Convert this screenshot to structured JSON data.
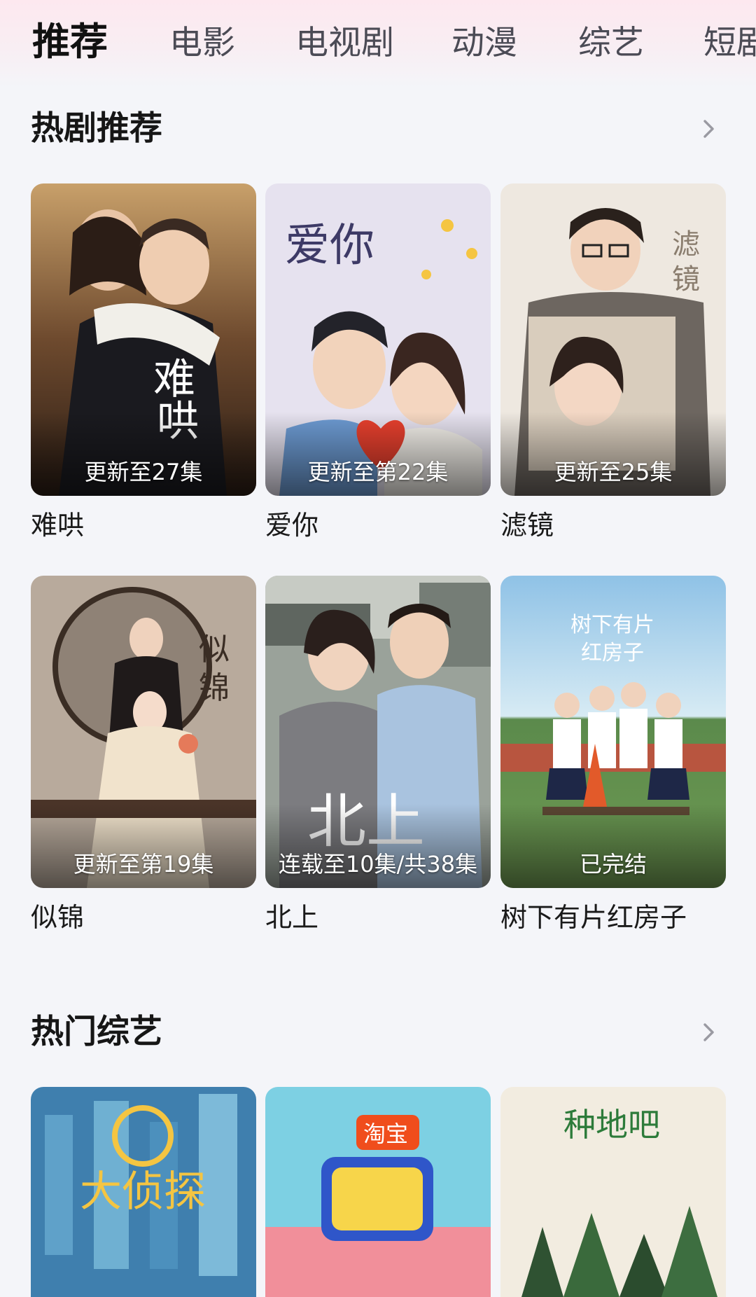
{
  "nav": {
    "tabs": [
      {
        "label": "推荐",
        "active": true
      },
      {
        "label": "电影",
        "active": false
      },
      {
        "label": "电视剧",
        "active": false
      },
      {
        "label": "动漫",
        "active": false
      },
      {
        "label": "综艺",
        "active": false
      },
      {
        "label": "短剧",
        "active": false
      }
    ]
  },
  "hot_dramas": {
    "title": "热剧推荐",
    "more_icon": "chevron-right-icon",
    "items": [
      {
        "title": "难哄",
        "badge": "更新至27集"
      },
      {
        "title": "爱你",
        "badge": "更新至第22集"
      },
      {
        "title": "滤镜",
        "badge": "更新至25集"
      },
      {
        "title": "似锦",
        "badge": "更新至第19集"
      },
      {
        "title": "北上",
        "badge": "连载至10集/共38集"
      },
      {
        "title": "树下有片红房子",
        "badge": "已完结"
      }
    ]
  },
  "hot_variety": {
    "title": "热门综艺",
    "more_icon": "chevron-right-icon",
    "items": [
      {
        "poster_text": "大侦探"
      },
      {
        "poster_text": "淘宝"
      },
      {
        "poster_text": "种地吧"
      }
    ]
  },
  "colors": {
    "background": "#f4f5f9",
    "header_tint": "#fde8ef",
    "text_primary": "#111111",
    "text_secondary": "#4b4b55",
    "chevron": "#9a9aa2"
  }
}
